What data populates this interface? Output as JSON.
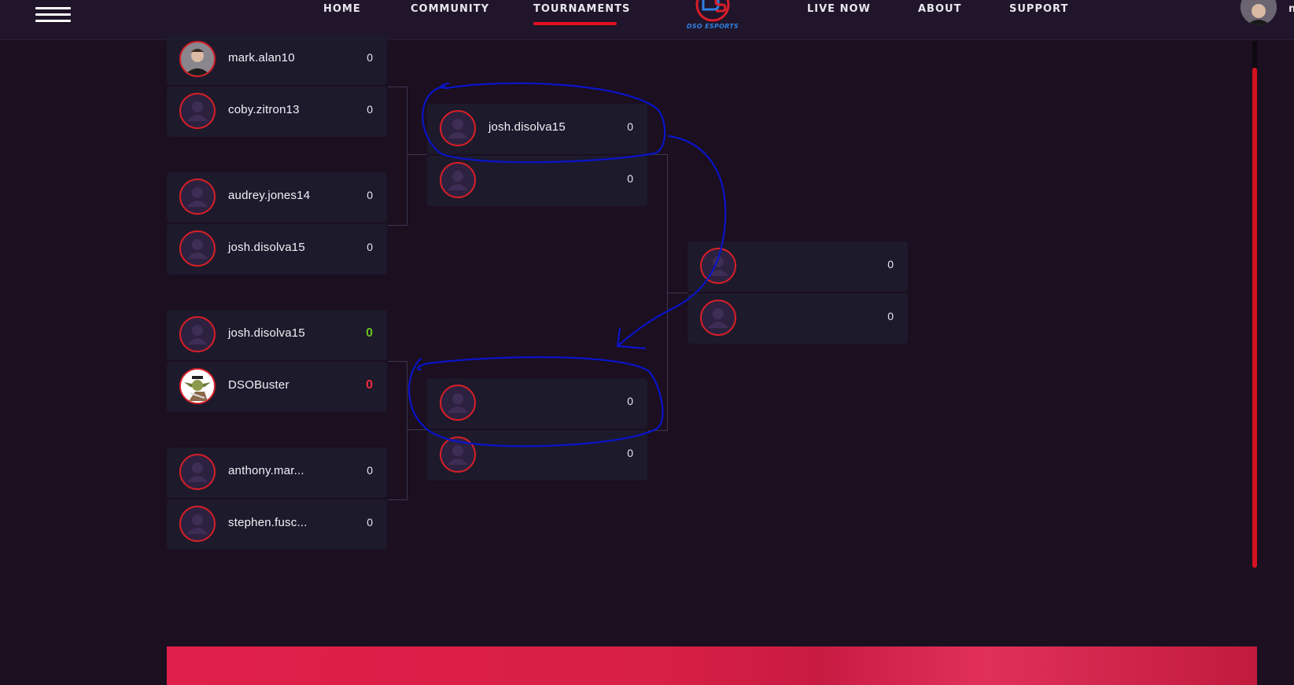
{
  "nav": {
    "items": [
      {
        "label": "HOME"
      },
      {
        "label": "COMMUNITY"
      },
      {
        "label": "TOURNAMENTS",
        "active": true
      },
      {
        "label": "LIVE NOW"
      },
      {
        "label": "ABOUT"
      },
      {
        "label": "SUPPORT"
      }
    ],
    "logo_text": "DSO ESPORTS",
    "user_name_fragment": "n"
  },
  "colors": {
    "background": "#1b0f20",
    "accent": "#e3101e",
    "slot_bg": "#1d1a2c",
    "annotation": "#0a14c8",
    "win_score": "#6bbf1f",
    "loss_score": "#ef2d3c"
  },
  "bracket": {
    "round1": [
      {
        "players": [
          {
            "name": "mark.alan10",
            "score": "0",
            "avatar": "photo"
          },
          {
            "name": "coby.zitron13",
            "score": "0",
            "avatar": "default"
          }
        ]
      },
      {
        "players": [
          {
            "name": "audrey.jones14",
            "score": "0",
            "avatar": "default"
          },
          {
            "name": "josh.disolva15",
            "score": "0",
            "avatar": "default"
          }
        ]
      },
      {
        "players": [
          {
            "name": "josh.disolva15",
            "score": "0",
            "avatar": "default",
            "result": "win"
          },
          {
            "name": "DSOBuster",
            "score": "0",
            "avatar": "yoda",
            "result": "loss"
          }
        ]
      },
      {
        "players": [
          {
            "name": "anthony.mar...",
            "score": "0",
            "avatar": "default"
          },
          {
            "name": "stephen.fusc...",
            "score": "0",
            "avatar": "default"
          }
        ]
      }
    ],
    "round2": [
      {
        "players": [
          {
            "name": "josh.disolva15",
            "score": "0",
            "avatar": "default"
          },
          {
            "name": "",
            "score": "0",
            "avatar": "default"
          }
        ]
      },
      {
        "players": [
          {
            "name": "",
            "score": "0",
            "avatar": "default"
          },
          {
            "name": "",
            "score": "0",
            "avatar": "default"
          }
        ]
      }
    ],
    "round3": [
      {
        "players": [
          {
            "name": "",
            "score": "0",
            "avatar": "default"
          },
          {
            "name": "",
            "score": "0",
            "avatar": "default"
          }
        ]
      }
    ]
  }
}
